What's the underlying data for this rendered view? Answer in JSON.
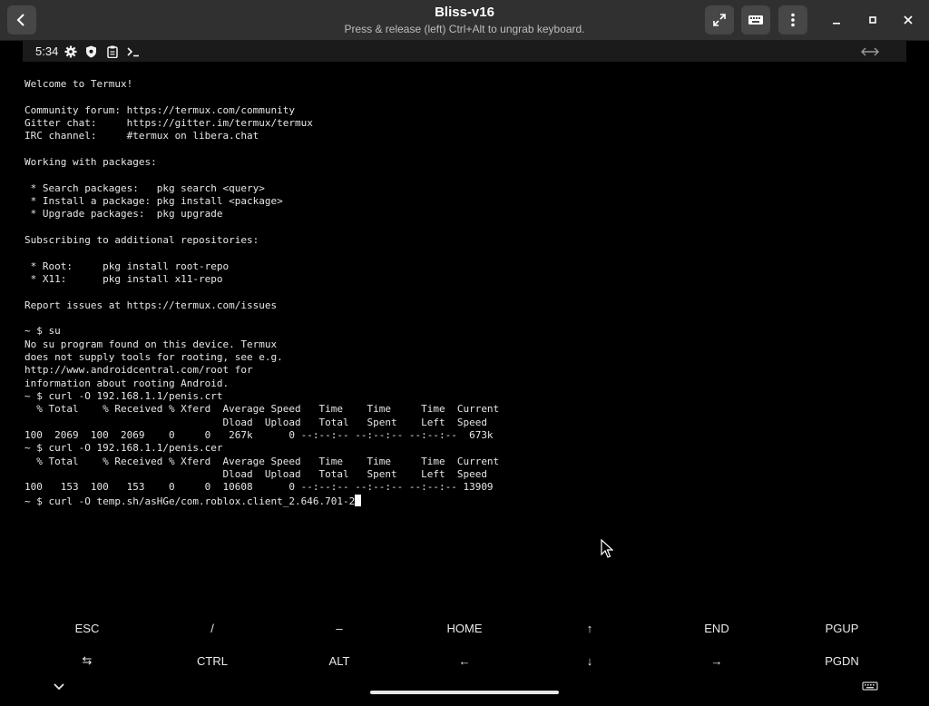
{
  "window": {
    "title": "Bliss-v16",
    "subtitle": "Press & release (left) Ctrl+Alt to ungrab keyboard.",
    "back_icon": "chevron-left-icon",
    "fullscreen_icon": "fullscreen-icon",
    "keyboard_icon": "keyboard-icon",
    "menu_icon": "kebab-menu-icon",
    "minimize_label": "–",
    "maximize_label": "▫",
    "close_label": "✕"
  },
  "statusbar": {
    "time": "5:34",
    "icons": [
      "gear-icon",
      "shield-icon",
      "clipboard-icon",
      "terminal-icon"
    ],
    "right_icon": "swap-icon"
  },
  "terminal": {
    "lines": [
      "Welcome to Termux!",
      "",
      "Community forum: https://termux.com/community",
      "Gitter chat:     https://gitter.im/termux/termux",
      "IRC channel:     #termux on libera.chat",
      "",
      "Working with packages:",
      "",
      " * Search packages:   pkg search <query>",
      " * Install a package: pkg install <package>",
      " * Upgrade packages:  pkg upgrade",
      "",
      "Subscribing to additional repositories:",
      "",
      " * Root:     pkg install root-repo",
      " * X11:      pkg install x11-repo",
      "",
      "Report issues at https://termux.com/issues",
      "",
      "~ $ su",
      "No su program found on this device. Termux",
      "does not supply tools for rooting, see e.g.",
      "http://www.androidcentral.com/root for",
      "information about rooting Android.",
      "~ $ curl -O 192.168.1.1/penis.crt",
      "  % Total    % Received % Xferd  Average Speed   Time    Time     Time  Current",
      "                                 Dload  Upload   Total   Spent    Left  Speed",
      "100  2069  100  2069    0     0   267k      0 --:--:-- --:--:-- --:--:--  673k",
      "~ $ curl -O 192.168.1.1/penis.cer",
      "  % Total    % Received % Xferd  Average Speed   Time    Time     Time  Current",
      "                                 Dload  Upload   Total   Spent    Left  Speed",
      "100   153  100   153    0     0  10608      0 --:--:-- --:--:-- --:--:-- 13909"
    ],
    "prompt_line": "~ $ curl -O temp.sh/asHGe/com.roblox.client_2.646.701-2"
  },
  "extra_keys": {
    "row1": [
      "ESC",
      "/",
      "–",
      "HOME",
      "↑",
      "END",
      "PGUP"
    ],
    "row2": [
      "⇆",
      "CTRL",
      "ALT",
      "←",
      "↓",
      "→",
      "PGDN"
    ]
  },
  "navbar": {
    "back_icon": "chevron-down-icon",
    "keyboard_icon": "keyboard-icon"
  },
  "colors": {
    "titlebar_bg": "#303030",
    "terminal_bg": "#000000",
    "terminal_fg": "#e6e6e6"
  }
}
